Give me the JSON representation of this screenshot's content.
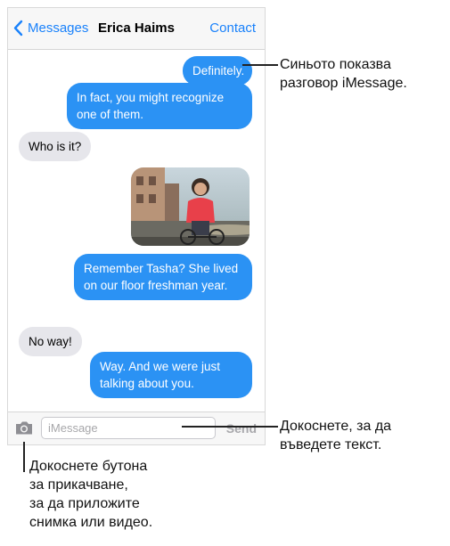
{
  "nav": {
    "back_label": "Messages",
    "title": "Erica Haims",
    "contact_label": "Contact"
  },
  "messages": [
    {
      "type": "sent",
      "text": "Definitely."
    },
    {
      "type": "sent",
      "text": "In fact, you might recognize one of them."
    },
    {
      "type": "received",
      "text": "Who is it?"
    },
    {
      "type": "sent-photo",
      "text": ""
    },
    {
      "type": "sent",
      "text": "Remember Tasha? She lived on our floor freshman year."
    },
    {
      "type": "received",
      "text": "No way!"
    },
    {
      "type": "sent",
      "text": "Way. And we were just talking about you."
    }
  ],
  "input_bar": {
    "placeholder": "iMessage",
    "send_label": "Send"
  },
  "callouts": {
    "blue_means_imessage_line1": "Синьото показва",
    "blue_means_imessage_line2": "разговор iMessage.",
    "tap_to_type_line1": "Докоснете, за да",
    "tap_to_type_line2": "въведете текст.",
    "attach_line1": "Докоснете бутона",
    "attach_line2": "за прикачване,",
    "attach_line3": "за да приложите",
    "attach_line4": "снимка или видео."
  },
  "colors": {
    "ios_blue": "#1a82fb",
    "imessage_bubble": "#2b92f4",
    "received_bubble": "#e6e6eb"
  }
}
